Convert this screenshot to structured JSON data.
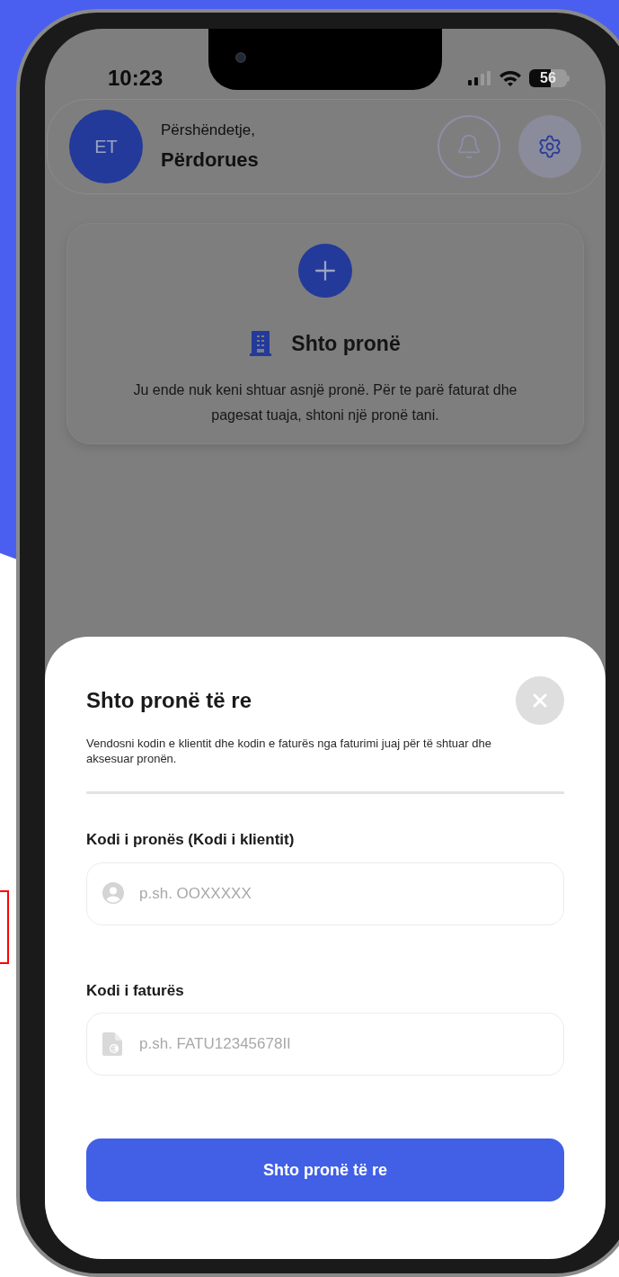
{
  "status_bar": {
    "time": "10:23",
    "battery": "56"
  },
  "header": {
    "avatar_initials": "ET",
    "greeting": "Përshëndetje,",
    "name": "Përdorues"
  },
  "empty_card": {
    "title": "Shto pronë",
    "message": "Ju ende nuk keni shtuar asnjë pronë. Për te parë faturat dhe pagesat tuaja, shtoni një pronë tani."
  },
  "sheet": {
    "title": "Shto pronë të re",
    "description": "Vendosni kodin e klientit dhe kodin e faturës nga faturimi juaj për të shtuar dhe aksesuar pronën.",
    "fields": [
      {
        "kind": "user",
        "label": "Kodi i pronës (Kodi i klientit)",
        "placeholder": "p.sh. OOXXXXX"
      },
      {
        "kind": "invoice",
        "label": "Kodi i faturës",
        "placeholder": "p.sh. FATU12345678II"
      }
    ],
    "submit": "Shto pronë të re"
  }
}
